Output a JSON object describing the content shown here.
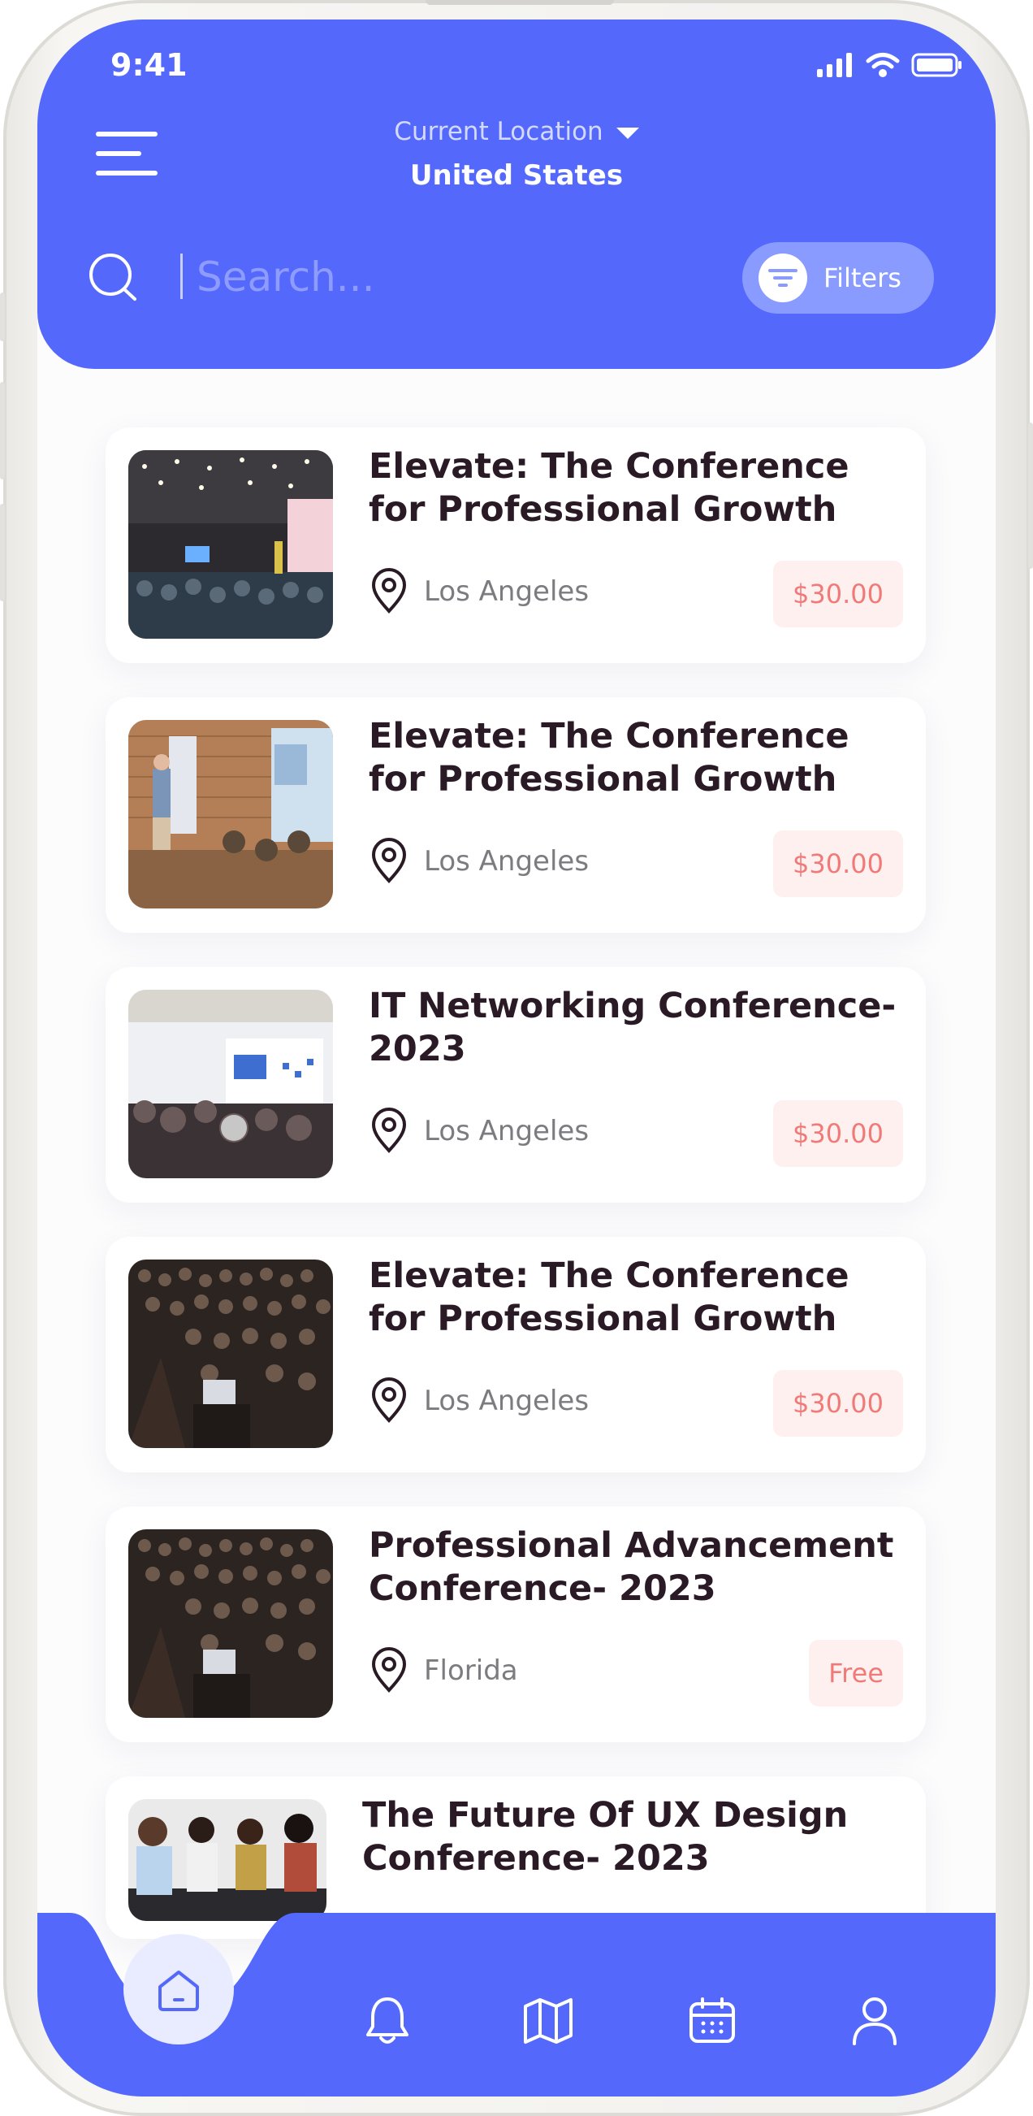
{
  "status_bar": {
    "time": "9:41"
  },
  "header": {
    "location_label": "Current Location",
    "location_value": "United States",
    "search_placeholder": "Search...",
    "filters_label": "Filters"
  },
  "colors": {
    "brand": "#5469fb",
    "price_text": "#f07a78",
    "price_bg": "#fff0f0",
    "title": "#2a1a25"
  },
  "events": [
    {
      "title": "Elevate: The Conference for Professional Growth",
      "location": "Los Angeles",
      "price": "$30.00",
      "image": "conference-hall-photo"
    },
    {
      "title": "Elevate: The Conference for Professional Growth",
      "location": "Los Angeles",
      "price": "$30.00",
      "image": "speaker-brick-room-photo"
    },
    {
      "title": "IT Networking Conference- 2023",
      "location": "Los Angeles",
      "price": "$30.00",
      "image": "networking-presentation-photo"
    },
    {
      "title": "Elevate: The Conference for Professional Growth",
      "location": "Los Angeles",
      "price": "$30.00",
      "image": "auditorium-crowd-photo"
    },
    {
      "title": "Professional Advancement Conference- 2023",
      "location": "Florida",
      "price": "Free",
      "image": "auditorium-crowd-photo"
    },
    {
      "title": "The Future Of UX Design Conference- 2023",
      "image": "team-meeting-photo"
    }
  ],
  "bottom_nav": {
    "items": [
      "home-icon",
      "bell-icon",
      "map-icon",
      "calendar-icon",
      "profile-icon"
    ],
    "active": "home-icon"
  }
}
